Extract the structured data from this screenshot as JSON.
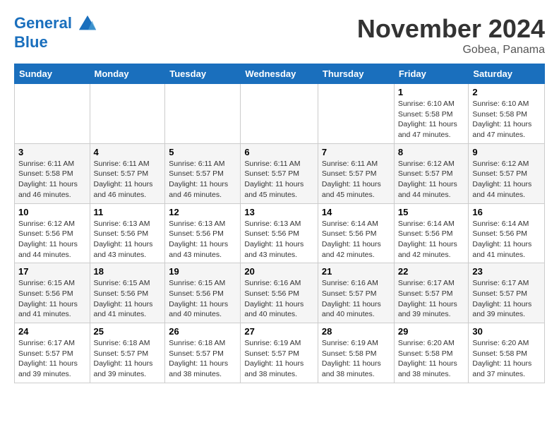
{
  "header": {
    "logo_line1": "General",
    "logo_line2": "Blue",
    "month_title": "November 2024",
    "subtitle": "Gobea, Panama"
  },
  "days_of_week": [
    "Sunday",
    "Monday",
    "Tuesday",
    "Wednesday",
    "Thursday",
    "Friday",
    "Saturday"
  ],
  "weeks": [
    [
      {
        "day": "",
        "info": ""
      },
      {
        "day": "",
        "info": ""
      },
      {
        "day": "",
        "info": ""
      },
      {
        "day": "",
        "info": ""
      },
      {
        "day": "",
        "info": ""
      },
      {
        "day": "1",
        "info": "Sunrise: 6:10 AM\nSunset: 5:58 PM\nDaylight: 11 hours\nand 47 minutes."
      },
      {
        "day": "2",
        "info": "Sunrise: 6:10 AM\nSunset: 5:58 PM\nDaylight: 11 hours\nand 47 minutes."
      }
    ],
    [
      {
        "day": "3",
        "info": "Sunrise: 6:11 AM\nSunset: 5:58 PM\nDaylight: 11 hours\nand 46 minutes."
      },
      {
        "day": "4",
        "info": "Sunrise: 6:11 AM\nSunset: 5:57 PM\nDaylight: 11 hours\nand 46 minutes."
      },
      {
        "day": "5",
        "info": "Sunrise: 6:11 AM\nSunset: 5:57 PM\nDaylight: 11 hours\nand 46 minutes."
      },
      {
        "day": "6",
        "info": "Sunrise: 6:11 AM\nSunset: 5:57 PM\nDaylight: 11 hours\nand 45 minutes."
      },
      {
        "day": "7",
        "info": "Sunrise: 6:11 AM\nSunset: 5:57 PM\nDaylight: 11 hours\nand 45 minutes."
      },
      {
        "day": "8",
        "info": "Sunrise: 6:12 AM\nSunset: 5:57 PM\nDaylight: 11 hours\nand 44 minutes."
      },
      {
        "day": "9",
        "info": "Sunrise: 6:12 AM\nSunset: 5:57 PM\nDaylight: 11 hours\nand 44 minutes."
      }
    ],
    [
      {
        "day": "10",
        "info": "Sunrise: 6:12 AM\nSunset: 5:56 PM\nDaylight: 11 hours\nand 44 minutes."
      },
      {
        "day": "11",
        "info": "Sunrise: 6:13 AM\nSunset: 5:56 PM\nDaylight: 11 hours\nand 43 minutes."
      },
      {
        "day": "12",
        "info": "Sunrise: 6:13 AM\nSunset: 5:56 PM\nDaylight: 11 hours\nand 43 minutes."
      },
      {
        "day": "13",
        "info": "Sunrise: 6:13 AM\nSunset: 5:56 PM\nDaylight: 11 hours\nand 43 minutes."
      },
      {
        "day": "14",
        "info": "Sunrise: 6:14 AM\nSunset: 5:56 PM\nDaylight: 11 hours\nand 42 minutes."
      },
      {
        "day": "15",
        "info": "Sunrise: 6:14 AM\nSunset: 5:56 PM\nDaylight: 11 hours\nand 42 minutes."
      },
      {
        "day": "16",
        "info": "Sunrise: 6:14 AM\nSunset: 5:56 PM\nDaylight: 11 hours\nand 41 minutes."
      }
    ],
    [
      {
        "day": "17",
        "info": "Sunrise: 6:15 AM\nSunset: 5:56 PM\nDaylight: 11 hours\nand 41 minutes."
      },
      {
        "day": "18",
        "info": "Sunrise: 6:15 AM\nSunset: 5:56 PM\nDaylight: 11 hours\nand 41 minutes."
      },
      {
        "day": "19",
        "info": "Sunrise: 6:15 AM\nSunset: 5:56 PM\nDaylight: 11 hours\nand 40 minutes."
      },
      {
        "day": "20",
        "info": "Sunrise: 6:16 AM\nSunset: 5:56 PM\nDaylight: 11 hours\nand 40 minutes."
      },
      {
        "day": "21",
        "info": "Sunrise: 6:16 AM\nSunset: 5:57 PM\nDaylight: 11 hours\nand 40 minutes."
      },
      {
        "day": "22",
        "info": "Sunrise: 6:17 AM\nSunset: 5:57 PM\nDaylight: 11 hours\nand 39 minutes."
      },
      {
        "day": "23",
        "info": "Sunrise: 6:17 AM\nSunset: 5:57 PM\nDaylight: 11 hours\nand 39 minutes."
      }
    ],
    [
      {
        "day": "24",
        "info": "Sunrise: 6:17 AM\nSunset: 5:57 PM\nDaylight: 11 hours\nand 39 minutes."
      },
      {
        "day": "25",
        "info": "Sunrise: 6:18 AM\nSunset: 5:57 PM\nDaylight: 11 hours\nand 39 minutes."
      },
      {
        "day": "26",
        "info": "Sunrise: 6:18 AM\nSunset: 5:57 PM\nDaylight: 11 hours\nand 38 minutes."
      },
      {
        "day": "27",
        "info": "Sunrise: 6:19 AM\nSunset: 5:57 PM\nDaylight: 11 hours\nand 38 minutes."
      },
      {
        "day": "28",
        "info": "Sunrise: 6:19 AM\nSunset: 5:58 PM\nDaylight: 11 hours\nand 38 minutes."
      },
      {
        "day": "29",
        "info": "Sunrise: 6:20 AM\nSunset: 5:58 PM\nDaylight: 11 hours\nand 38 minutes."
      },
      {
        "day": "30",
        "info": "Sunrise: 6:20 AM\nSunset: 5:58 PM\nDaylight: 11 hours\nand 37 minutes."
      }
    ]
  ]
}
